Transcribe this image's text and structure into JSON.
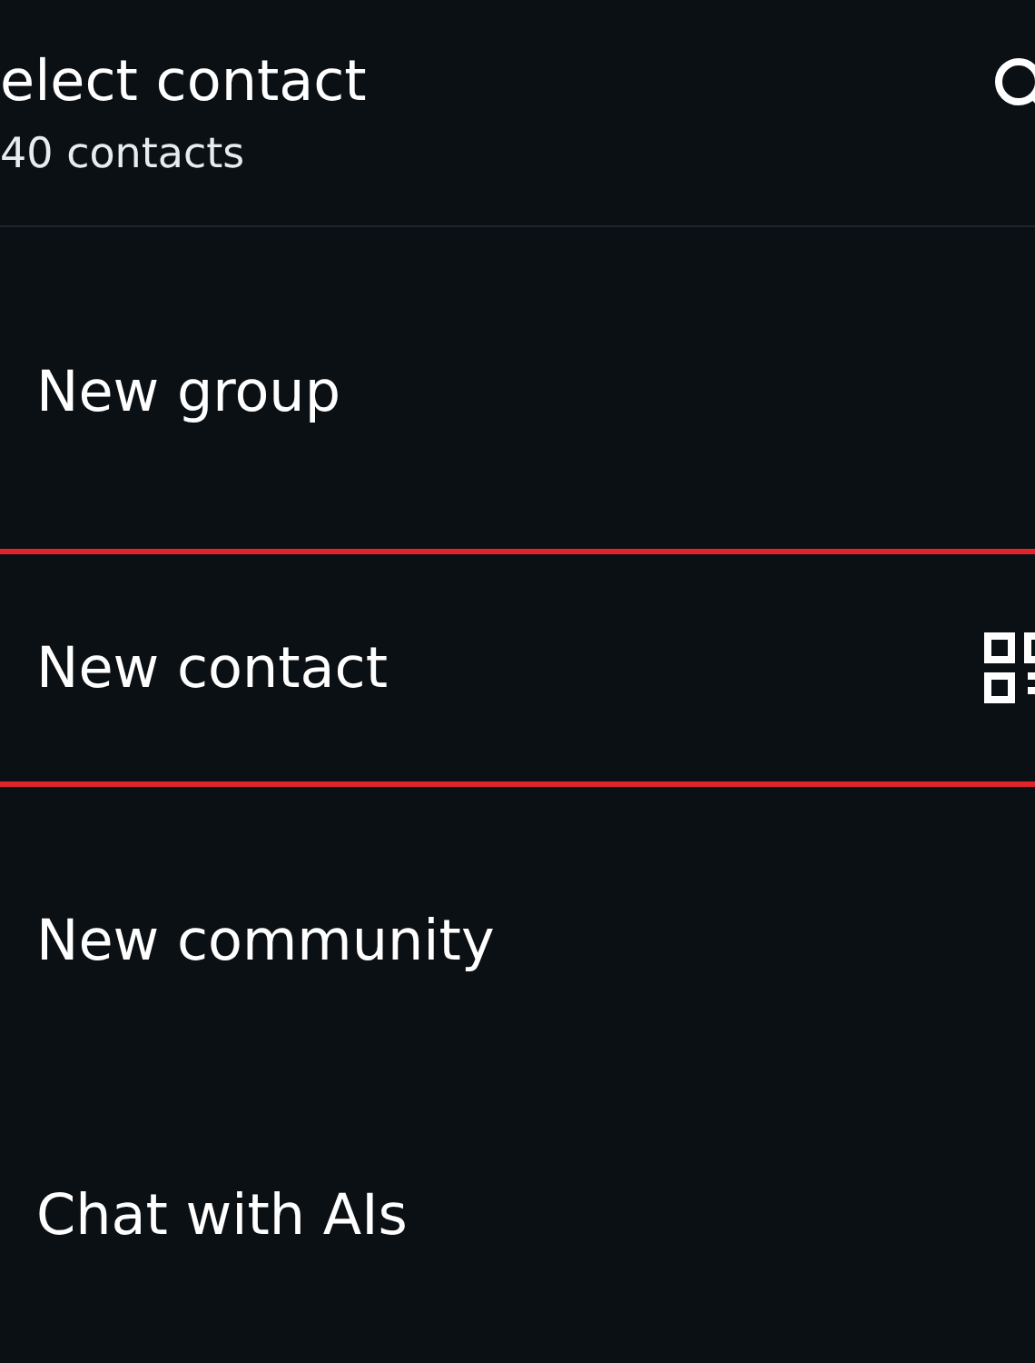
{
  "header": {
    "title": "elect contact",
    "subtitle": "40 contacts"
  },
  "items": [
    {
      "label": "New group",
      "highlighted": false,
      "kind": "plain"
    },
    {
      "label": "New contact",
      "highlighted": true,
      "kind": "qr"
    },
    {
      "label": "New community",
      "highlighted": false,
      "kind": "plain"
    },
    {
      "label": "Chat with AIs",
      "highlighted": false,
      "kind": "plain"
    }
  ]
}
